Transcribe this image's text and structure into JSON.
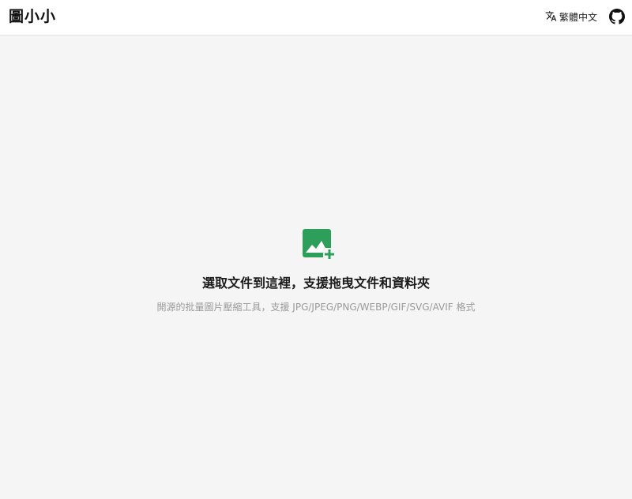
{
  "header": {
    "logo": "圖小小",
    "language": {
      "icon": "translate-icon",
      "label": "繁體中文"
    },
    "github_icon": "github-icon"
  },
  "dropzone": {
    "icon": "add-image-icon",
    "title": "選取文件到這裡，支援拖曳文件和資料夾",
    "subtitle": "開源的批量圖片壓縮工具，支援 JPG/JPEG/PNG/WEBP/GIF/SVG/AVIF 格式"
  },
  "colors": {
    "accent": "#2e9e5b",
    "background": "#f5f5f5",
    "header_bg": "#ffffff",
    "subtitle": "#9a9a9a"
  }
}
